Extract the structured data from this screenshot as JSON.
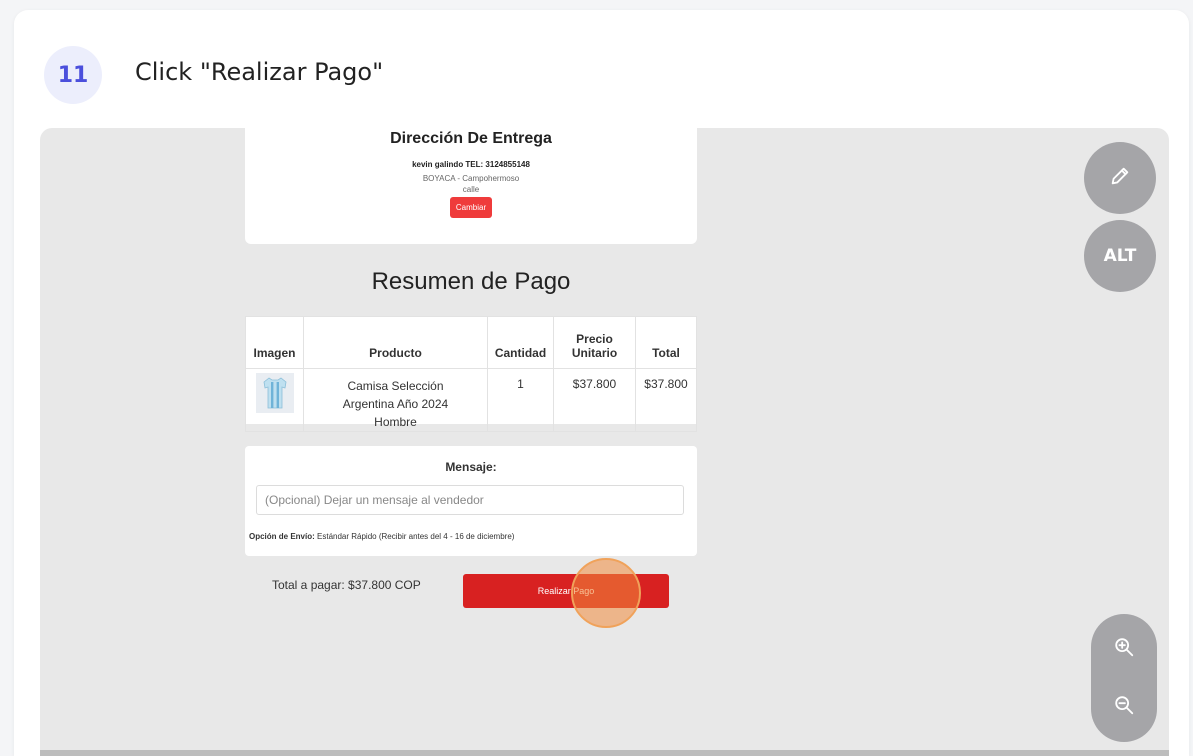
{
  "step": {
    "number": "11",
    "title": "Click \"Realizar Pago\""
  },
  "delivery": {
    "heading": "Dirección De Entrega",
    "recipient": "kevin galindo TEL: 3124855148",
    "region": "BOYACA - Campohermoso",
    "street": "calle",
    "change_label": "Cambiar"
  },
  "summary": {
    "title": "Resumen de Pago",
    "columns": [
      "Imagen",
      "Producto",
      "Cantidad",
      "Precio Unitario",
      "Total"
    ],
    "rows": [
      {
        "image_icon": "shirt-thumbnail",
        "product": "Camisa Selección Argentina Año 2024 Hombre",
        "quantity": "1",
        "unit_price": "$37.800",
        "total": "$37.800"
      }
    ]
  },
  "message": {
    "label": "Mensaje:",
    "placeholder": "(Opcional) Dejar un mensaje al vendedor",
    "shipping_label": "Opción de Envío:",
    "shipping_value": "Estándar Rápido (Recibir antes del 4 - 16 de diciembre)"
  },
  "checkout": {
    "total_text": "Total a pagar: $37.800 COP",
    "pay_label": "Realizar Pago"
  },
  "tools": {
    "edit_icon": "pencil-icon",
    "alt_label": "ALT",
    "zoom_in_icon": "zoom-in-icon",
    "zoom_out_icon": "zoom-out-icon"
  },
  "colors": {
    "accent": "#4b4fdc",
    "pay_button": "#d82121",
    "change_button": "#ef3b3b",
    "click_marker": "#f08a3c"
  }
}
